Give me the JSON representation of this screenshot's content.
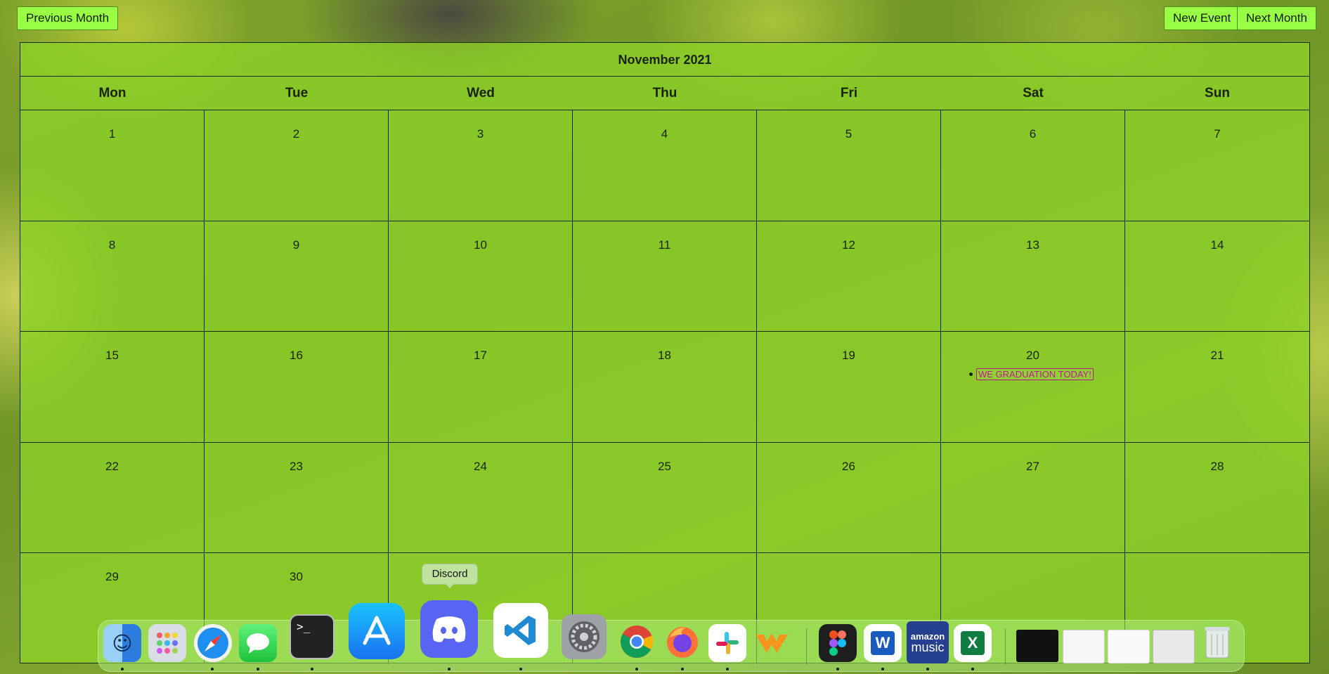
{
  "toolbar": {
    "prev_label": "Previous Month",
    "new_event_label": "New Event",
    "next_label": "Next Month"
  },
  "calendar": {
    "title": "November 2021",
    "weekdays": [
      "Mon",
      "Tue",
      "Wed",
      "Thu",
      "Fri",
      "Sat",
      "Sun"
    ],
    "weeks": [
      [
        "1",
        "2",
        "3",
        "4",
        "5",
        "6",
        "7"
      ],
      [
        "8",
        "9",
        "10",
        "11",
        "12",
        "13",
        "14"
      ],
      [
        "15",
        "16",
        "17",
        "18",
        "19",
        "20",
        "21"
      ],
      [
        "22",
        "23",
        "24",
        "25",
        "26",
        "27",
        "28"
      ],
      [
        "29",
        "30",
        "",
        "",
        "",
        "",
        ""
      ]
    ],
    "event": {
      "day": "20",
      "label": "WE GRADUATION TODAY!"
    }
  },
  "dock": {
    "tooltip": "Discord",
    "apps": [
      {
        "name": "Finder",
        "icon": "finder-icon"
      },
      {
        "name": "Launchpad",
        "icon": "launchpad-icon"
      },
      {
        "name": "Safari",
        "icon": "safari-icon"
      },
      {
        "name": "Messages",
        "icon": "messages-icon"
      },
      {
        "name": "Terminal",
        "icon": "terminal-icon",
        "glyph": ">_"
      },
      {
        "name": "App Store",
        "icon": "app-store-icon"
      },
      {
        "name": "Discord",
        "icon": "discord-icon"
      },
      {
        "name": "Visual Studio Code",
        "icon": "vscode-icon"
      },
      {
        "name": "System Preferences",
        "icon": "system-preferences-icon"
      },
      {
        "name": "Chrome",
        "icon": "chrome-icon"
      },
      {
        "name": "Firefox",
        "icon": "firefox-icon"
      },
      {
        "name": "Slack",
        "icon": "slack-icon"
      },
      {
        "name": "Wondershare",
        "icon": "wondershare-icon"
      },
      {
        "name": "Figma",
        "icon": "figma-icon"
      },
      {
        "name": "Word",
        "icon": "word-icon",
        "glyph": "W"
      },
      {
        "name": "Amazon Music",
        "icon": "amazon-music-icon",
        "glyph_top": "amazon",
        "glyph_bottom": "music"
      },
      {
        "name": "Excel",
        "icon": "excel-icon",
        "glyph": "X"
      }
    ]
  },
  "colors": {
    "button_bg": "#99ff44",
    "calendar_overlay": "#8cd228",
    "event_text": "#c2169a"
  }
}
